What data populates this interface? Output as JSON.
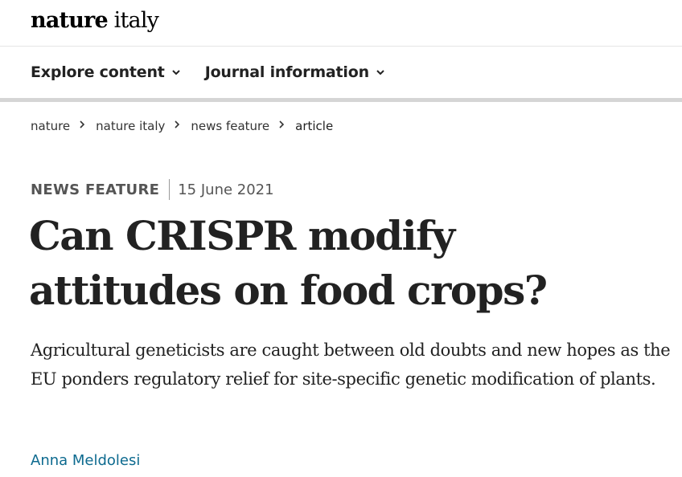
{
  "masthead": {
    "brand_bold": "nature",
    "brand_light": "italy"
  },
  "nav": {
    "items": [
      {
        "label": "Explore content"
      },
      {
        "label": "Journal information"
      }
    ]
  },
  "breadcrumb": [
    {
      "label": "nature"
    },
    {
      "label": "nature italy"
    },
    {
      "label": "news feature"
    },
    {
      "label": "article"
    }
  ],
  "article": {
    "type": "NEWS FEATURE",
    "date": "15 June 2021",
    "title_line1": "Can CRISPR modify",
    "title_line2": "attitudes on food crops?",
    "standfirst": "Agricultural geneticists are caught between old doubts and new hopes as the EU ponders regulatory relief for site-specific genetic modification of plants.",
    "author": "Anna Meldolesi"
  },
  "colors": {
    "link": "#0d6a8f",
    "text": "#222222",
    "rule": "#d5d5d5"
  }
}
